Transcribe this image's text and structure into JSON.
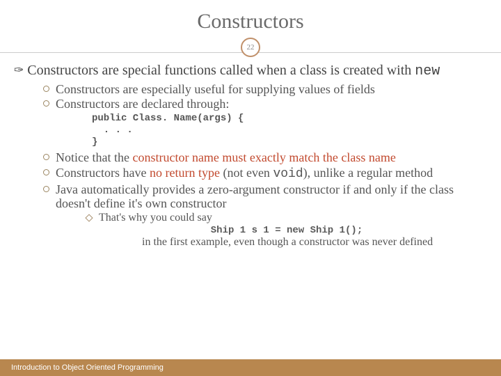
{
  "title": "Constructors",
  "page_number": "22",
  "main_bullet": {
    "prefix": "Constructors are special functions called when a class is created with ",
    "keyword": "new"
  },
  "subs": {
    "s1": "Constructors are especially useful for supplying values of fields",
    "s2": "Constructors are declared through:",
    "code1_l1": "public Class. Name(args) {",
    "code1_l2": "  . . .",
    "code1_l3": "}",
    "s3_a": "Notice that the ",
    "s3_b": "constructor name must exactly match the class name",
    "s4_a": "Constructors have ",
    "s4_b": "no return type",
    "s4_c": " (not even ",
    "s4_void": "void",
    "s4_d": "), unlike a regular method",
    "s5": "Java automatically provides a zero-argument constructor if and only if the class doesn't define it's own constructor",
    "n1": "That's why you could say",
    "code2": "Ship 1 s 1 = new Ship 1();",
    "n2": "in the first example, even though a constructor was never defined"
  },
  "footer": "Introduction to Object Oriented Programming"
}
